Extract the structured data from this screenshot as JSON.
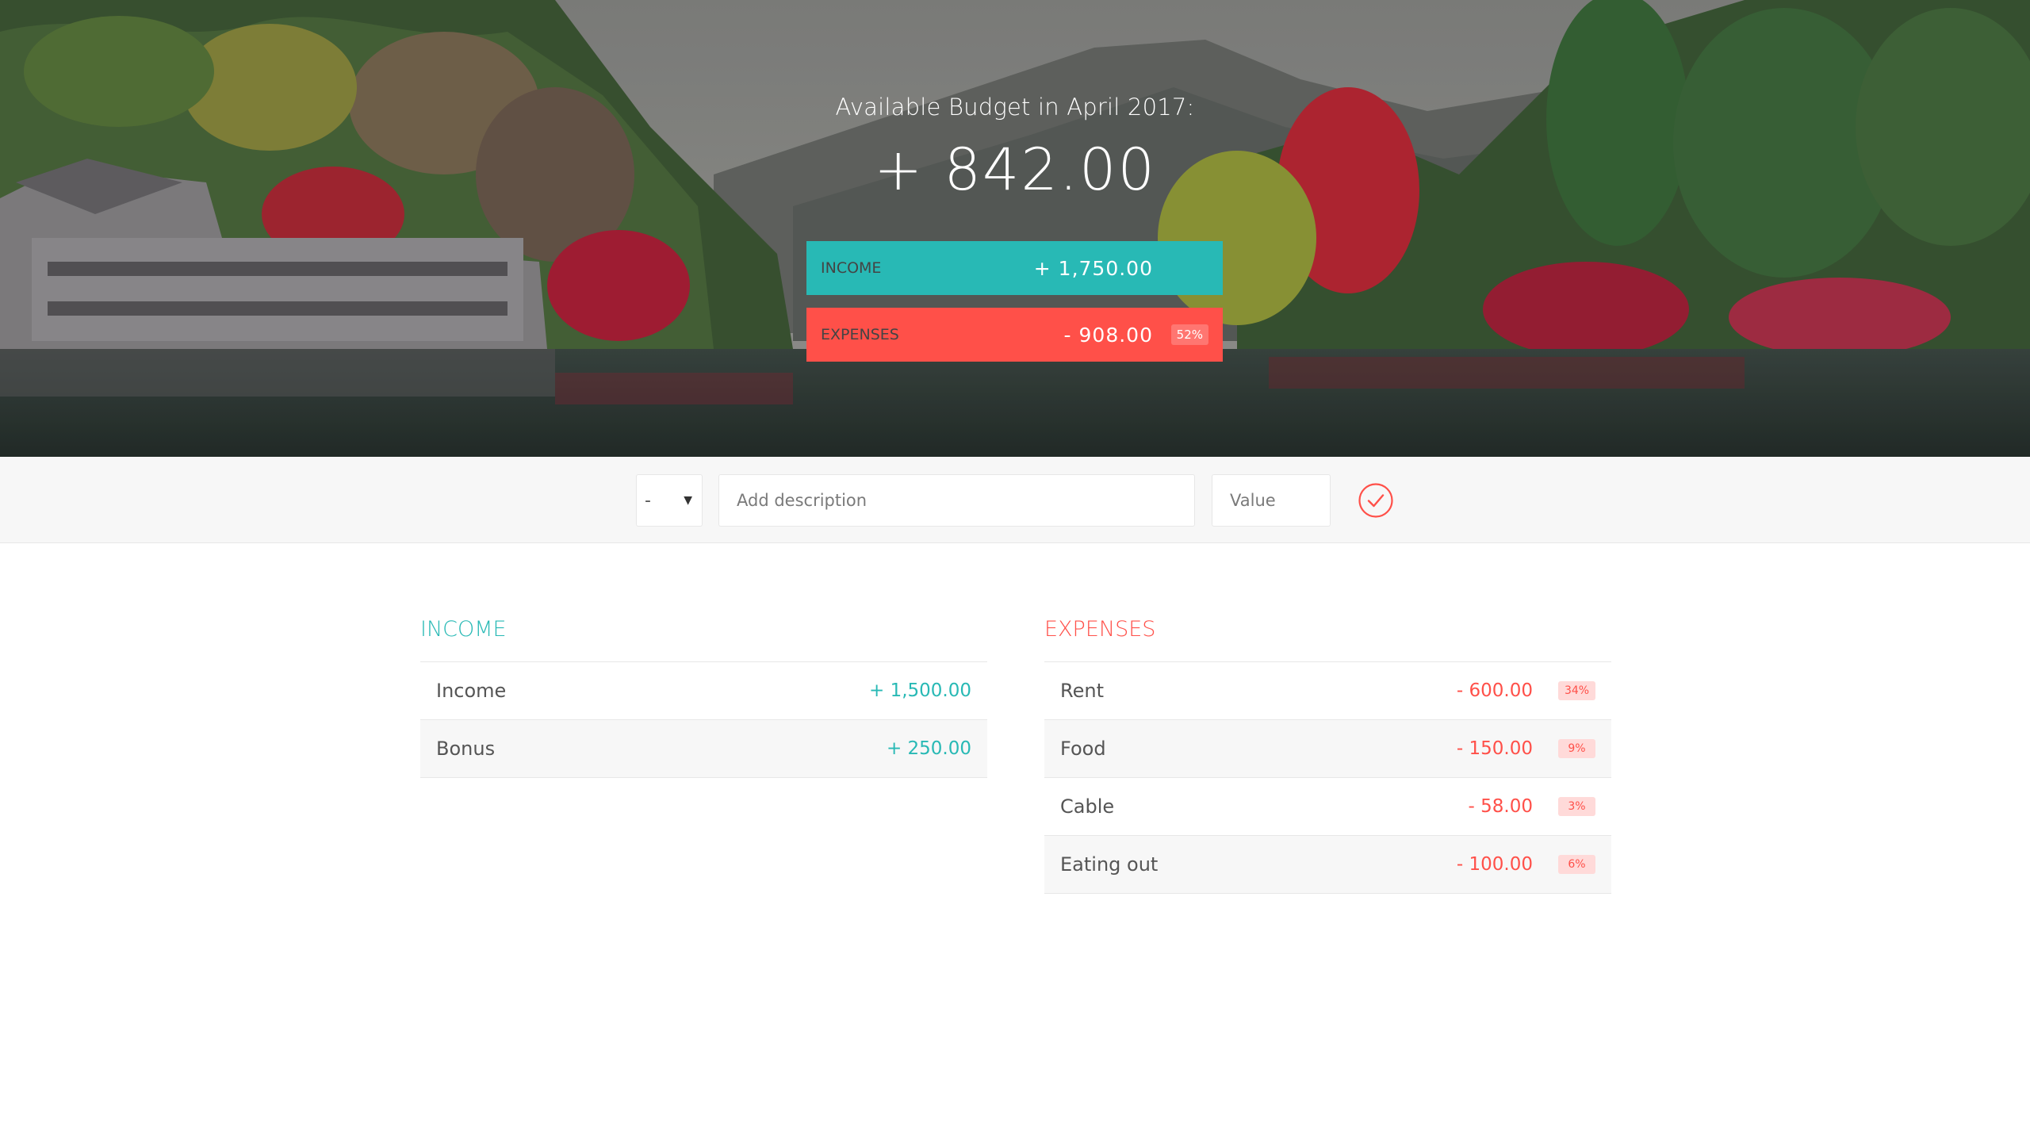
{
  "header": {
    "title": "Available Budget in April 2017:",
    "budget": "+ 842.00",
    "income_label": "INCOME",
    "income_value": "+ 1,750.00",
    "expenses_label": "EXPENSES",
    "expenses_value": "- 908.00",
    "expenses_percent": "52%"
  },
  "add_form": {
    "type_value": "-",
    "description_placeholder": "Add description",
    "value_placeholder": "Value",
    "submit_icon": "checkmark-circle-icon"
  },
  "income": {
    "title": "INCOME",
    "items": [
      {
        "description": "Income",
        "value": "+ 1,500.00"
      },
      {
        "description": "Bonus",
        "value": "+ 250.00"
      }
    ]
  },
  "expenses": {
    "title": "EXPENSES",
    "items": [
      {
        "description": "Rent",
        "value": "- 600.00",
        "percent": "34%"
      },
      {
        "description": "Food",
        "value": "- 150.00",
        "percent": "9%"
      },
      {
        "description": "Cable",
        "value": "- 58.00",
        "percent": "3%"
      },
      {
        "description": "Eating out",
        "value": "- 100.00",
        "percent": "6%"
      }
    ]
  },
  "colors": {
    "income": "#28b9b5",
    "expenses": "#ff5049",
    "percent_badge_bg": "#ffdad9",
    "add_bar_bg": "#f7f7f7"
  }
}
